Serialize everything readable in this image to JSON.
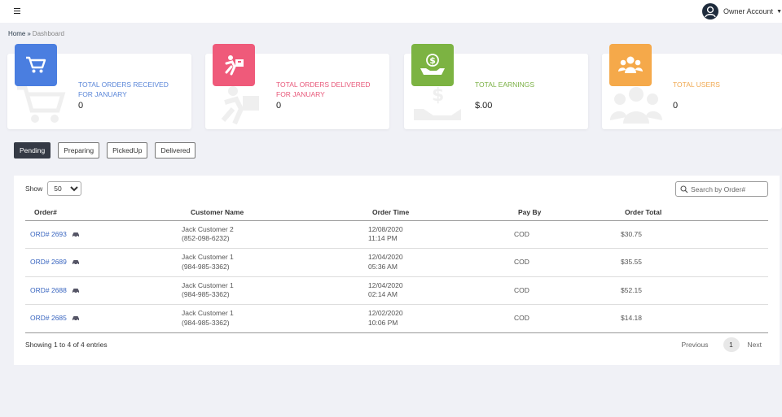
{
  "account": {
    "name": "Owner Account"
  },
  "breadcrumb": {
    "home": "Home",
    "sep": "»",
    "current": "Dashboard"
  },
  "stats": [
    {
      "label": "TOTAL ORDERS RECEIVED FOR JANUARY",
      "value": "0",
      "color": "#4a7ee0",
      "text_color": "#5a86d8",
      "icon": "cart-icon"
    },
    {
      "label": "TOTAL ORDERS DELIVERED FOR JANUARY",
      "value": "0",
      "color": "#ef5a7a",
      "text_color": "#e8587a",
      "icon": "delivery-man-icon"
    },
    {
      "label": "TOTAL EARNINGS",
      "value": "$.00",
      "color": "#7cb342",
      "text_color": "#7ab043",
      "icon": "money-hand-icon"
    },
    {
      "label": "TOTAL USERS",
      "value": "0",
      "color": "#f5a94a",
      "text_color": "#f0a850",
      "icon": "users-icon"
    }
  ],
  "tabs": [
    "Pending",
    "Preparing",
    "PickedUp",
    "Delivered"
  ],
  "table": {
    "show_label": "Show",
    "show_value": "50",
    "search_placeholder": "Search by Order#",
    "headers": [
      "Order#",
      "Customer Name",
      "Order Time",
      "Pay By",
      "Order Total"
    ],
    "rows": [
      {
        "order": "ORD# 2693",
        "customer": "Jack Customer 2",
        "phone": "(852-098-6232)",
        "date": "12/08/2020",
        "time": "11:14 PM",
        "pay": "COD",
        "total": "$30.75"
      },
      {
        "order": "ORD# 2689",
        "customer": "Jack Customer 1",
        "phone": "(984-985-3362)",
        "date": "12/04/2020",
        "time": "05:36 AM",
        "pay": "COD",
        "total": "$35.55"
      },
      {
        "order": "ORD# 2688",
        "customer": "Jack Customer 1",
        "phone": "(984-985-3362)",
        "date": "12/04/2020",
        "time": "02:14 AM",
        "pay": "COD",
        "total": "$52.15"
      },
      {
        "order": "ORD# 2685",
        "customer": "Jack Customer 1",
        "phone": "(984-985-3362)",
        "date": "12/02/2020",
        "time": "10:06 PM",
        "pay": "COD",
        "total": "$14.18"
      }
    ],
    "info": "Showing 1 to 4 of 4 entries",
    "pager": {
      "prev": "Previous",
      "page": "1",
      "next": "Next"
    }
  }
}
